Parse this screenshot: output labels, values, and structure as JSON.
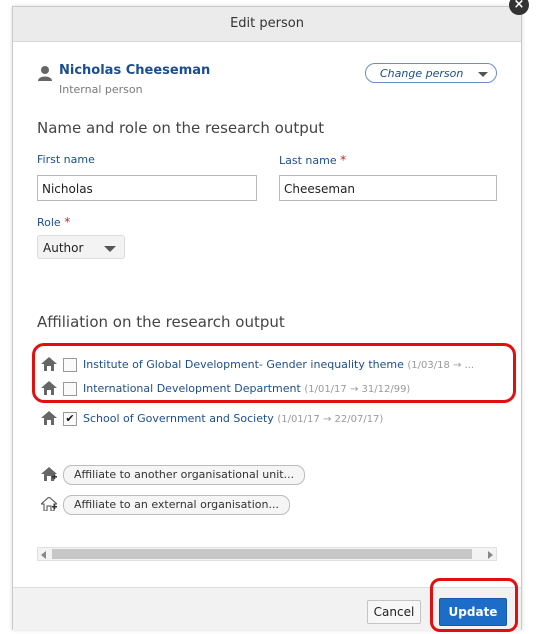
{
  "dialog": {
    "title": "Edit person",
    "close_glyph": "×"
  },
  "person": {
    "name": "Nicholas Cheeseman",
    "type": "Internal person",
    "change_label": "Change person",
    "icon": "person-icon"
  },
  "name_section": {
    "title": "Name and role on the research output",
    "first_name_label": "First name",
    "first_name_value": "Nicholas",
    "last_name_label": "Last name",
    "last_name_value": "Cheeseman",
    "role_label": "Role",
    "role_value": "Author",
    "required_mark": "*"
  },
  "affiliation_section": {
    "title": "Affiliation on the research output",
    "items": [
      {
        "name": "Institute of Global Development- Gender inequality theme",
        "dates": "(1/03/18 → ...",
        "checked": false
      },
      {
        "name": "International Development Department",
        "dates": "(1/01/17 → 31/12/99)",
        "checked": false
      },
      {
        "name": "School of Government and Society",
        "dates": "(1/01/17 → 22/07/17)",
        "checked": true
      }
    ],
    "check_glyph": "✔",
    "affiliate_internal_label": "Affiliate to another organisational unit...",
    "affiliate_external_label": "Affiliate to an external organisation..."
  },
  "footer": {
    "cancel_label": "Cancel",
    "update_label": "Update"
  },
  "colors": {
    "link": "#1c4e8f",
    "primary": "#1c6cc8",
    "highlight": "#e01010",
    "required": "#c0272d"
  }
}
